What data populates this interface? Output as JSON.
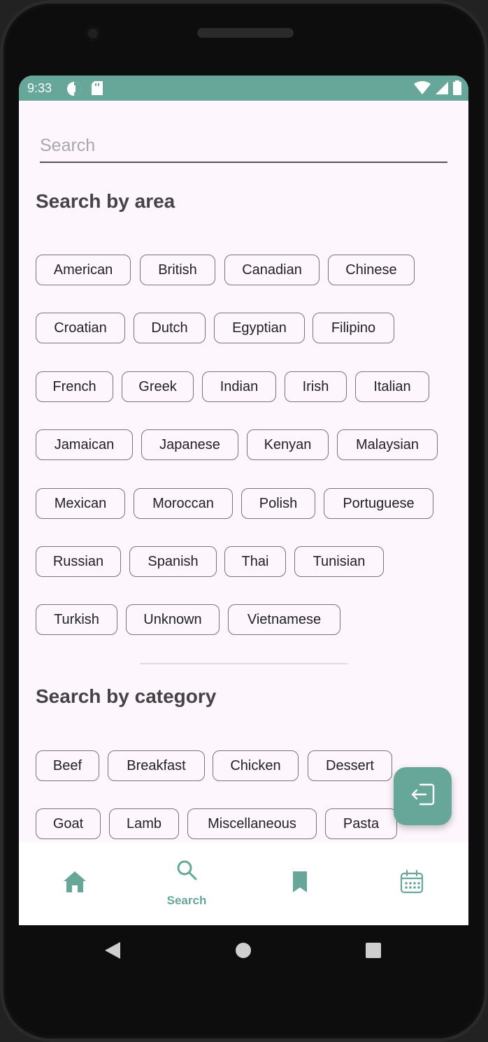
{
  "status": {
    "time": "9:33"
  },
  "search": {
    "placeholder": "Search"
  },
  "area_section": {
    "title": "Search by area",
    "chips": [
      "American",
      "British",
      "Canadian",
      "Chinese",
      "Croatian",
      "Dutch",
      "Egyptian",
      "Filipino",
      "French",
      "Greek",
      "Indian",
      "Irish",
      "Italian",
      "Jamaican",
      "Japanese",
      "Kenyan",
      "Malaysian",
      "Mexican",
      "Moroccan",
      "Polish",
      "Portuguese",
      "Russian",
      "Spanish",
      "Thai",
      "Tunisian",
      "Turkish",
      "Unknown",
      "Vietnamese"
    ]
  },
  "category_section": {
    "title": "Search by category",
    "chips": [
      "Beef",
      "Breakfast",
      "Chicken",
      "Dessert",
      "Goat",
      "Lamb",
      "Miscellaneous",
      "Pasta"
    ]
  },
  "bottom_nav": {
    "items": [
      {
        "icon": "home-icon",
        "label": ""
      },
      {
        "icon": "search-icon",
        "label": "Search"
      },
      {
        "icon": "bookmark-icon",
        "label": ""
      },
      {
        "icon": "calendar-icon",
        "label": ""
      }
    ],
    "active": 1
  },
  "colors": {
    "accent": "#67a79a",
    "background": "#fdf6fc"
  }
}
